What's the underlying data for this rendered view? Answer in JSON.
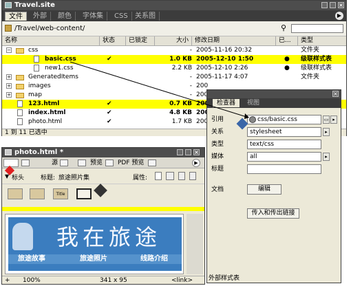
{
  "site": {
    "title": "Travel.site",
    "tabs": [
      "文件",
      "外部",
      "颜色",
      "字体集",
      "CSS",
      "关系图"
    ],
    "path": "/Travel/web-content/",
    "columns": [
      "名称",
      "状态",
      "已锁定",
      "大小",
      "修改日期",
      "已...",
      "类型"
    ],
    "rows": [
      {
        "name": "css",
        "status": "",
        "locked": "",
        "size": "-",
        "date": "2005-11-16 20:32",
        "mark": "",
        "type": "文件夹"
      },
      {
        "name": "basic.css",
        "status": "✔",
        "locked": "",
        "size": "1.0 KB",
        "date": "2005-12-10 1:50",
        "mark": "●",
        "type": "级联样式表"
      },
      {
        "name": "new1.css",
        "status": "",
        "locked": "",
        "size": "2.2 KB",
        "date": "2005-12-10 2:26",
        "mark": "●",
        "type": "级联样式表"
      },
      {
        "name": "GeneratedItems",
        "status": "",
        "locked": "",
        "size": "-",
        "date": "2005-11-17 4:07",
        "mark": "",
        "type": "文件夹"
      },
      {
        "name": "images",
        "status": "",
        "locked": "",
        "size": "-",
        "date": "200",
        "mark": "",
        "type": ""
      },
      {
        "name": "map",
        "status": "",
        "locked": "",
        "size": "-",
        "date": "200",
        "mark": "",
        "type": ""
      },
      {
        "name": "123.html",
        "status": "✔",
        "locked": "",
        "size": "0.7 KB",
        "date": "200",
        "mark": "",
        "type": ""
      },
      {
        "name": "index.html",
        "status": "✔",
        "locked": "",
        "size": "4.8 KB",
        "date": "200",
        "mark": "",
        "type": ""
      },
      {
        "name": "photo.html",
        "status": "✔",
        "locked": "",
        "size": "1.7 KB",
        "date": "200",
        "mark": "",
        "type": ""
      }
    ],
    "status": "1 到 11 已选中"
  },
  "inspector": {
    "tabs": [
      "检查器",
      "视图"
    ],
    "fields": [
      {
        "label": "引用",
        "value": "css/basic.css"
      },
      {
        "label": "关系",
        "value": "stylesheet"
      },
      {
        "label": "类型",
        "value": "text/css"
      },
      {
        "label": "媒体",
        "value": "all"
      },
      {
        "label": "标题",
        "value": ""
      }
    ],
    "doc_label": "文档",
    "edit_button": "编辑",
    "links_button": "传入和传出链接",
    "status": "外部样式表"
  },
  "doc": {
    "title": "photo.html *",
    "toolbar": [
      "源",
      "预览",
      "PDF 预览"
    ],
    "tag_label": "标头",
    "title_label": "标题:",
    "title_value": "旅途照片集",
    "attr_label": "属性:",
    "asset_labels": [
      "",
      "",
      "Title",
      ""
    ],
    "banner_title": "我在旅途",
    "banner_links": [
      "旅途故事",
      "旅途照片",
      "线路介绍"
    ],
    "zoom": "100%",
    "size": "341 x 95",
    "tag": "<link>"
  },
  "colors": {
    "highlight": "#ffff00",
    "chrome": "#4d4d4d",
    "banner": "#3b7dbf"
  }
}
